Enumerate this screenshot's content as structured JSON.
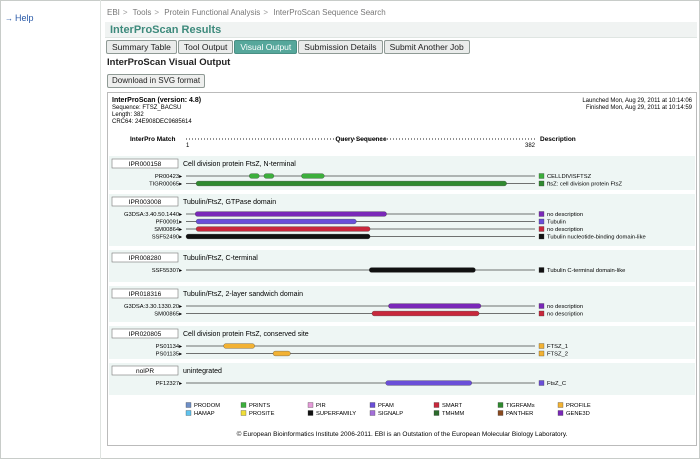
{
  "sidebar": {
    "help_label": "Help"
  },
  "breadcrumb": [
    "EBI",
    "Tools",
    "Protein Functional Analysis",
    "InterProScan Sequence Search"
  ],
  "page": {
    "title": "InterProScan Results",
    "subtitle": "InterProScan Visual Output",
    "download_label": "Download in SVG format"
  },
  "tabs": [
    {
      "label": "Summary Table",
      "active": false
    },
    {
      "label": "Tool Output",
      "active": false
    },
    {
      "label": "Visual Output",
      "active": true
    },
    {
      "label": "Submission Details",
      "active": false
    },
    {
      "label": "Submit Another Job",
      "active": false
    }
  ],
  "viz": {
    "version": "InterProScan (version: 4.8)",
    "sequence": "Sequence: FTSZ_BACSU",
    "length_text": "Length: 382",
    "crc": "CRC64: 24E908DEC9685614",
    "launched": "Launched Mon, Aug 29, 2011 at 10:14:06",
    "finished": "Finished Mon, Aug 29, 2011 at 10:14:59",
    "col_match": "InterPro Match",
    "col_query": "Query Sequence",
    "col_desc": "Description",
    "seq_start": "1",
    "seq_end": "382",
    "seq_length": 382,
    "groups": [
      {
        "id": "IPR000158",
        "name": "Cell division protein FtsZ, N-terminal",
        "matches": [
          {
            "label": "PR00423",
            "db": "PRINTS",
            "desc": "CELLDIVISFTSZ",
            "ranges": [
              [
                70,
                81
              ],
              [
                86,
                97
              ],
              [
                127,
                152
              ]
            ]
          },
          {
            "label": "TIGR00065",
            "db": "TIGRFAMs",
            "desc": "ftsZ: cell division protein FtsZ",
            "ranges": [
              [
                12,
                351
              ]
            ]
          }
        ]
      },
      {
        "id": "IPR003008",
        "name": "Tubulin/FtsZ, GTPase domain",
        "matches": [
          {
            "label": "G3DSA:3.40.50.1440",
            "db": "GENE3D",
            "desc": "no description",
            "ranges": [
              [
                11,
                220
              ]
            ]
          },
          {
            "label": "PF00091",
            "db": "PFAM",
            "desc": "Tubulin",
            "ranges": [
              [
                12,
                187
              ]
            ]
          },
          {
            "label": "SM00864",
            "db": "SMART",
            "desc": "no description",
            "ranges": [
              [
                12,
                202
              ]
            ]
          },
          {
            "label": "SSF52490",
            "db": "SUPERFAMILY",
            "desc": "Tubulin nucleotide-binding domain-like",
            "ranges": [
              [
                1,
                202
              ]
            ]
          }
        ]
      },
      {
        "id": "IPR008280",
        "name": "Tubulin/FtsZ, C-terminal",
        "matches": [
          {
            "label": "SSF55307",
            "db": "SUPERFAMILY",
            "desc": "Tubulin C-terminal domain-like",
            "ranges": [
              [
                201,
                317
              ]
            ]
          }
        ]
      },
      {
        "id": "IPR018316",
        "name": "Tubulin/FtsZ, 2-layer sandwich domain",
        "matches": [
          {
            "label": "G3DSA:3.30.1330.20",
            "db": "GENE3D",
            "desc": "no description",
            "ranges": [
              [
                222,
                323
              ]
            ]
          },
          {
            "label": "SM00865",
            "db": "SMART",
            "desc": "no description",
            "ranges": [
              [
                204,
                321
              ]
            ]
          }
        ]
      },
      {
        "id": "IPR020805",
        "name": "Cell division protein FtsZ, conserved site",
        "matches": [
          {
            "label": "PS01134",
            "db": "PROFILE",
            "desc": "FTSZ_1",
            "ranges": [
              [
                42,
                76
              ]
            ]
          },
          {
            "label": "PS01135",
            "db": "PROFILE",
            "desc": "FTSZ_2",
            "ranges": [
              [
                96,
                115
              ]
            ]
          }
        ]
      },
      {
        "id": "noIPR",
        "name": "unintegrated",
        "matches": [
          {
            "label": "PF12327",
            "db": "PFAM",
            "desc": "FtsZ_C",
            "ranges": [
              [
                219,
                313
              ]
            ]
          }
        ]
      }
    ],
    "legend": [
      {
        "name": "PRODOM",
        "color": "#6e8fc7"
      },
      {
        "name": "PRINTS",
        "color": "#3caf3c"
      },
      {
        "name": "PIR",
        "color": "#e49ad8"
      },
      {
        "name": "PFAM",
        "color": "#6a4fd8"
      },
      {
        "name": "SMART",
        "color": "#c8283c"
      },
      {
        "name": "TIGRFAMs",
        "color": "#2f8a2f"
      },
      {
        "name": "PROFILE",
        "color": "#f2b233"
      },
      {
        "name": "HAMAP",
        "color": "#5fc3ee"
      },
      {
        "name": "PROSITE",
        "color": "#f0de3a"
      },
      {
        "name": "SUPERFAMILY",
        "color": "#111111"
      },
      {
        "name": "SIGNALP",
        "color": "#a46fd9"
      },
      {
        "name": "TMHMM",
        "color": "#2c6b2c"
      },
      {
        "name": "PANTHER",
        "color": "#8a4a1f"
      },
      {
        "name": "GENE3D",
        "color": "#7a28b8"
      }
    ],
    "copyright": "© European Bioinformatics Institute 2006-2011. EBI is an Outstation of the European Molecular Biology Laboratory."
  }
}
